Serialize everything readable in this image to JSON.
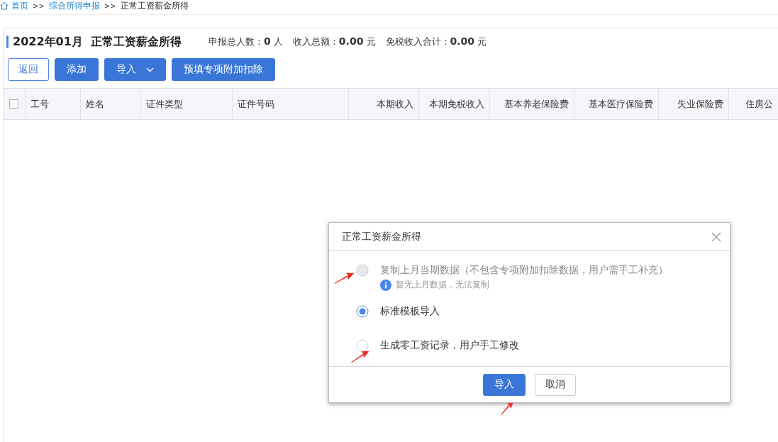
{
  "breadcrumb": [
    {
      "label": "首页",
      "link": true
    },
    {
      "label": "综合所得申报",
      "link": true
    },
    {
      "label": "正常工资薪金所得",
      "link": false
    }
  ],
  "breadcrumb_separator": ">>",
  "header": {
    "title": "2022年01月  正常工资薪金所得",
    "stats": [
      {
        "label": "申报总人数：",
        "value": "0",
        "unit": "人"
      },
      {
        "label": "收入总额：",
        "value": "0.00",
        "unit": "元"
      },
      {
        "label": "免税收入合计：",
        "value": "0.00",
        "unit": "元"
      }
    ]
  },
  "toolbar": [
    {
      "label": "返回",
      "kind": "outline"
    },
    {
      "label": "添加",
      "kind": "primary"
    },
    {
      "label": "导入",
      "kind": "dropdown"
    },
    {
      "label": "预填专项附加扣除",
      "kind": "primary"
    }
  ],
  "table": {
    "select_all_checked": false,
    "columns": [
      {
        "label": "工号",
        "kind": "text"
      },
      {
        "label": "姓名",
        "kind": "text"
      },
      {
        "label": "证件类型",
        "kind": "text"
      },
      {
        "label": "证件号码",
        "kind": "text"
      },
      {
        "label": "本期收入",
        "kind": "amount"
      },
      {
        "label": "本期免税收入",
        "kind": "amount"
      },
      {
        "label": "基本养老保险费",
        "kind": "amount"
      },
      {
        "label": "基本医疗保险费",
        "kind": "amount"
      },
      {
        "label": "失业保险费",
        "kind": "amount"
      },
      {
        "label": "住房公",
        "kind": "amount"
      }
    ]
  },
  "dialog": {
    "title": "正常工资薪金所得",
    "options": [
      {
        "label": "复制上月当期数据（不包含专项附加扣除数据，用户需手工补充）",
        "selected": false,
        "disabled": true,
        "note": "暂无上月数据，无法复制"
      },
      {
        "label": "标准模板导入",
        "selected": true,
        "disabled": false
      },
      {
        "label": "生成零工资记录，用户手工修改",
        "selected": false,
        "disabled": false
      }
    ],
    "buttons": [
      {
        "label": "导入",
        "kind": "primary"
      },
      {
        "label": "取消",
        "kind": "default"
      }
    ]
  }
}
